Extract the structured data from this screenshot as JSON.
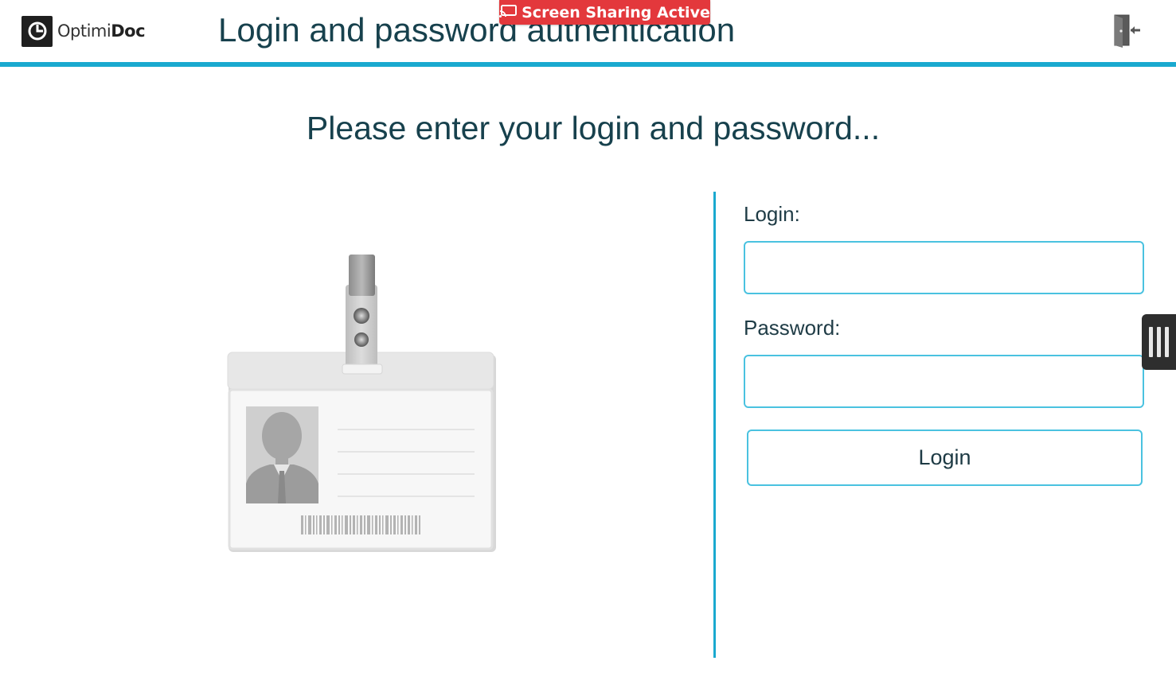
{
  "header": {
    "logo_text_regular": "Optimi",
    "logo_text_bold": "Doc",
    "title": "Login and password authentication",
    "exit_icon": "exit-door-icon"
  },
  "screen_share": {
    "label": "Screen Sharing Active",
    "icon": "screen-cast-icon",
    "color": "#e3383c"
  },
  "main": {
    "prompt": "Please enter your login and password..."
  },
  "form": {
    "login_label": "Login:",
    "login_value": "",
    "password_label": "Password:",
    "password_value": "",
    "submit_label": "Login"
  },
  "colors": {
    "accent": "#1aa9cf",
    "title_text": "#17414d"
  },
  "side_handle": {
    "icon": "panel-grip-icon"
  }
}
